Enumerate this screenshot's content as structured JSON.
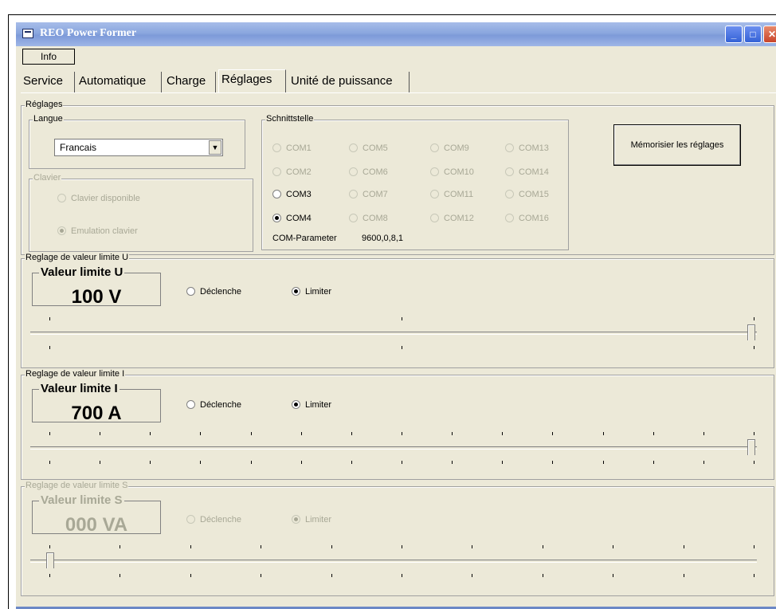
{
  "window": {
    "title": "REO Power Former"
  },
  "menu": {
    "info": "Info"
  },
  "tabs": [
    "Service",
    "Automatique",
    "Charge",
    "Réglages",
    "Unité de puissance"
  ],
  "active_tab": "Réglages",
  "reglages": {
    "legend": "Réglages",
    "langue": {
      "legend": "Langue",
      "selected": "Francais"
    },
    "clavier": {
      "legend": "Clavier",
      "options": [
        "Clavier disponible",
        "Emulation clavier"
      ],
      "selected": "Emulation clavier"
    },
    "schnittstelle": {
      "legend": "Schnittstelle",
      "ports": [
        "COM1",
        "COM5",
        "COM9",
        "COM13",
        "COM2",
        "COM6",
        "COM10",
        "COM14",
        "COM3",
        "COM7",
        "COM11",
        "COM15",
        "COM4",
        "COM8",
        "COM12",
        "COM16"
      ],
      "enabled": [
        "COM3",
        "COM4"
      ],
      "selected": "COM4",
      "param_label": "COM-Parameter",
      "param_value": "9600,0,8,1"
    },
    "save_button": "Mémorisier les réglages"
  },
  "limit_u": {
    "legend": "Reglage de valeur limite U",
    "title": "Valeur limite U",
    "value": "100 V",
    "opt1": "Déclenche",
    "opt2": "Limiter",
    "selected": "Limiter",
    "slider_level": 1.0
  },
  "limit_i": {
    "legend": "Reglage de valeur limite I",
    "title": "Valeur limite I",
    "value": "700 A",
    "opt1": "Déclenche",
    "opt2": "Limiter",
    "selected": "Limiter",
    "slider_level": 1.0
  },
  "limit_s": {
    "legend": "Reglage de valeur limite S",
    "title": "Valeur limite S",
    "value": "000 VA",
    "opt1": "Déclenche",
    "opt2": "Limiter",
    "selected": "Limiter",
    "slider_level": 0.0,
    "disabled": true
  },
  "icons": {
    "app": "window-app-icon",
    "minimize": "minimize-icon",
    "maximize": "maximize-icon",
    "close": "close-icon",
    "dropdown": "chevron-down-icon"
  }
}
